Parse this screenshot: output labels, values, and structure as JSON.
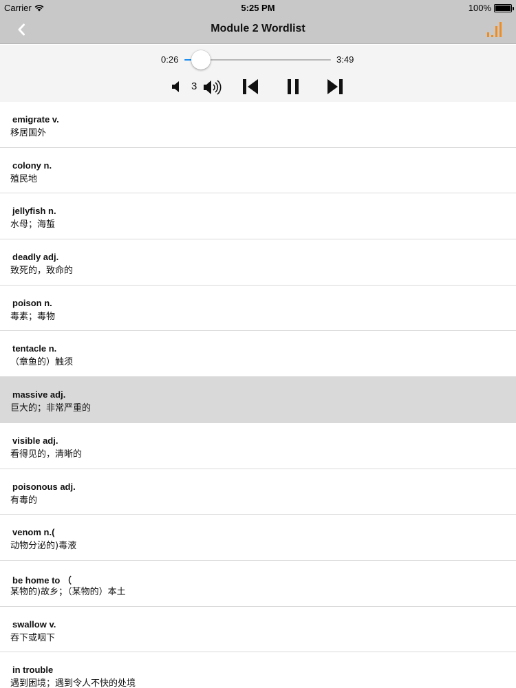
{
  "status_bar": {
    "carrier": "Carrier",
    "time": "5:25 PM",
    "battery": "100%"
  },
  "nav": {
    "title": "Module 2 Wordlist",
    "back_icon": "chevron-left-icon",
    "right_icon": "bar-chart-icon",
    "accent_color": "#f08c1e"
  },
  "player": {
    "current_time": "0:26",
    "duration": "3:49",
    "progress": 0.115,
    "volume_level": "3",
    "progress_color": "#1a8cf0"
  },
  "words": [
    {
      "word": "emigrate v.",
      "meaning": "移居国外"
    },
    {
      "word": "colony n.",
      "meaning": "殖民地"
    },
    {
      "word": "jellyfish n.",
      "meaning": "水母；海蜇"
    },
    {
      "word": "deadly adj.",
      "meaning": "致死的，致命的"
    },
    {
      "word": "poison n.",
      "meaning": "毒素；毒物"
    },
    {
      "word": "tentacle n.",
      "meaning": "（章鱼的）触须"
    },
    {
      "word": "massive adj.",
      "meaning": "巨大的；非常严重的"
    },
    {
      "word": "visible adj.",
      "meaning": "看得见的，清晰的"
    },
    {
      "word": "poisonous adj.",
      "meaning": "有毒的"
    },
    {
      "word": "venom n.(",
      "meaning": "动物分泌的)毒液"
    },
    {
      "word": "be home to （",
      "meaning": "某物的)故乡；（某物的）本土"
    },
    {
      "word": "swallow v.",
      "meaning": "吞下或咽下"
    },
    {
      "word": "in trouble",
      "meaning": "遇到困境；遇到令人不快的处境"
    }
  ],
  "selected_index": 6
}
